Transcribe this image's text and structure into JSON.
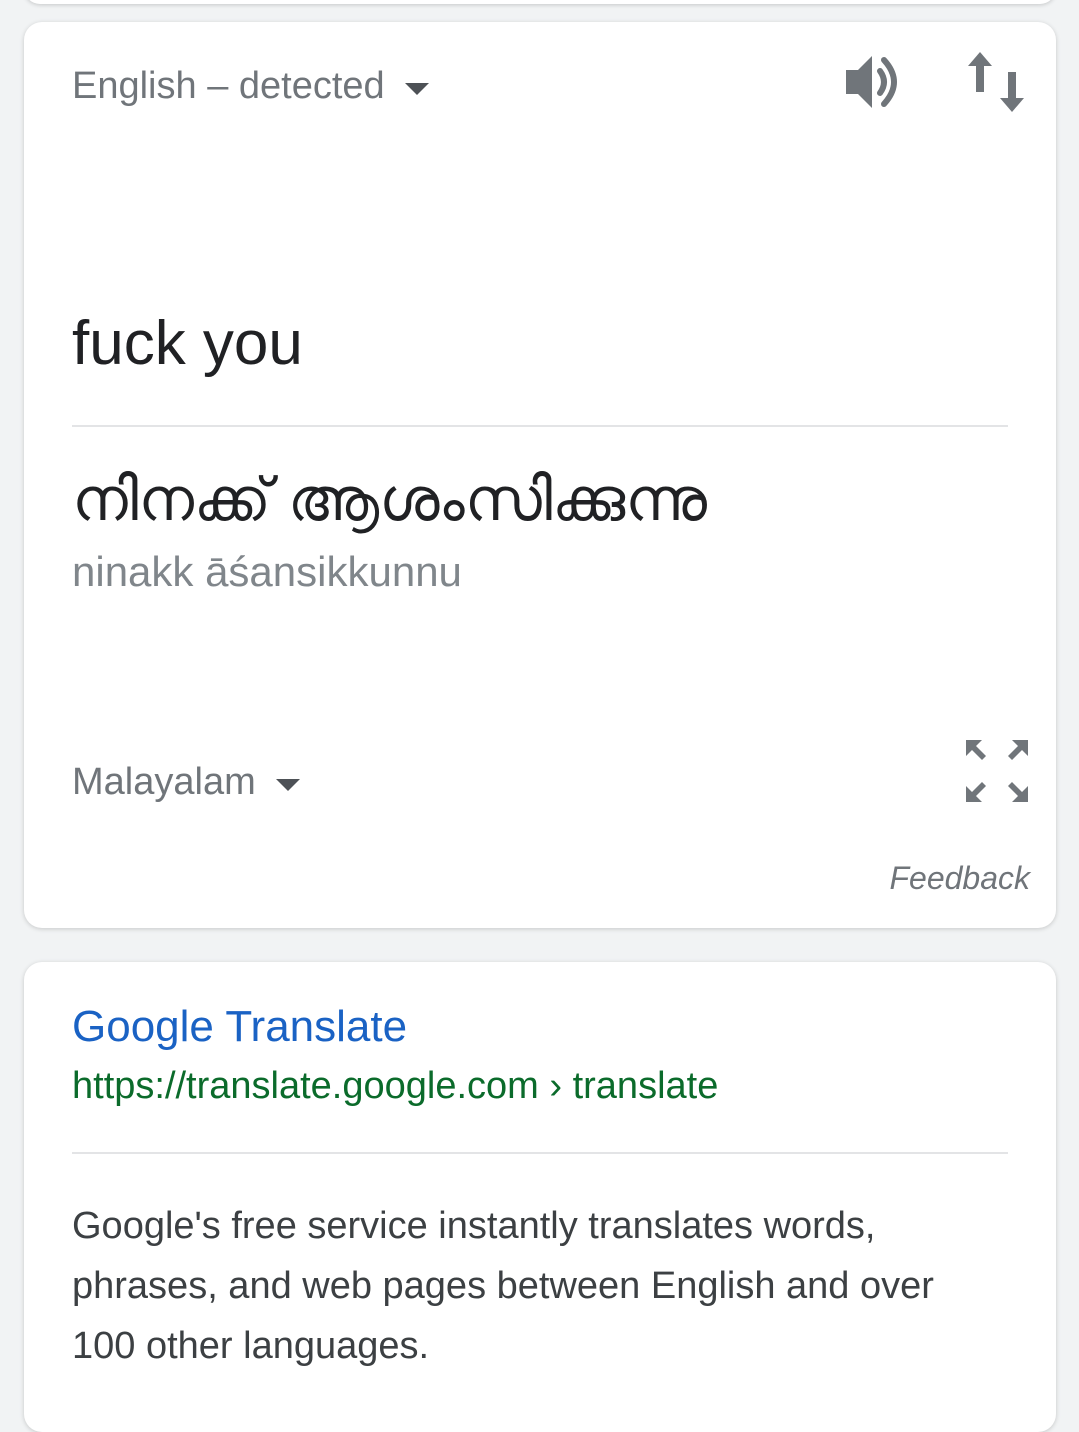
{
  "translate": {
    "source_language": "English – detected",
    "target_language": "Malayalam",
    "source_text": "fuck you",
    "translated_text": "നിനക്ക് ആശംസിക്കുന്നു",
    "romanization": "ninakk āśansikkunnu",
    "feedback_label": "Feedback",
    "icons": {
      "speaker": "speaker-icon",
      "swap": "swap-languages-icon",
      "expand": "expand-icon",
      "dropdown": "caret-down-icon"
    }
  },
  "result": {
    "title": "Google Translate",
    "url": "https://translate.google.com › translate",
    "snippet": "Google's free service instantly translates words, phrases, and web pages between English and over 100 other languages."
  },
  "colors": {
    "link_blue": "#1a62c4",
    "url_green": "#0b6b2b",
    "secondary_text": "#70757a",
    "primary_text": "#202124"
  }
}
